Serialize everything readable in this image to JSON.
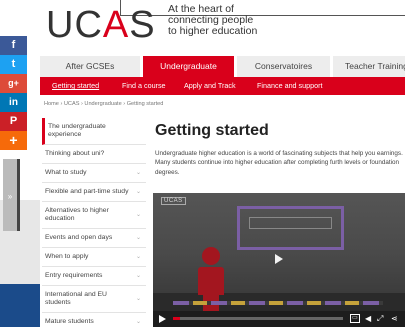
{
  "header": {
    "logo_text_1": "UC",
    "logo_text_2": "A",
    "logo_text_3": "S",
    "tagline_line1": "At the heart of",
    "tagline_line2": "connecting people",
    "tagline_line3": "to higher education"
  },
  "main_tabs": [
    {
      "label": "After GCSEs"
    },
    {
      "label": "Undergraduate"
    },
    {
      "label": "Conservatoires"
    },
    {
      "label": "Teacher Training"
    }
  ],
  "subnav": [
    {
      "label": "Getting started"
    },
    {
      "label": "Find a course"
    },
    {
      "label": "Apply and Track"
    },
    {
      "label": "Finance and support"
    }
  ],
  "breadcrumb": "Home › UCAS › Undergraduate › Getting started",
  "sidebar": [
    {
      "label": "The undergraduate experience"
    },
    {
      "label": "Thinking about uni?"
    },
    {
      "label": "What to study"
    },
    {
      "label": "Flexible and part-time study"
    },
    {
      "label": "Alternatives to higher education"
    },
    {
      "label": "Events and open days"
    },
    {
      "label": "When to apply"
    },
    {
      "label": "Entry requirements"
    },
    {
      "label": "International and EU students"
    },
    {
      "label": "Mature students"
    }
  ],
  "social": {
    "facebook": "f",
    "twitter": "t",
    "googleplus": "g+",
    "linkedin": "in",
    "pinterest": "P",
    "more": "+",
    "toggle": "»"
  },
  "content": {
    "title": "Getting started",
    "intro": "Undergraduate higher education is a world of fascinating subjects that help you earnings. Many students continue into higher education after completing furth levels or foundation degrees."
  },
  "video": {
    "logo": "UCAS",
    "progress": 0.04
  }
}
